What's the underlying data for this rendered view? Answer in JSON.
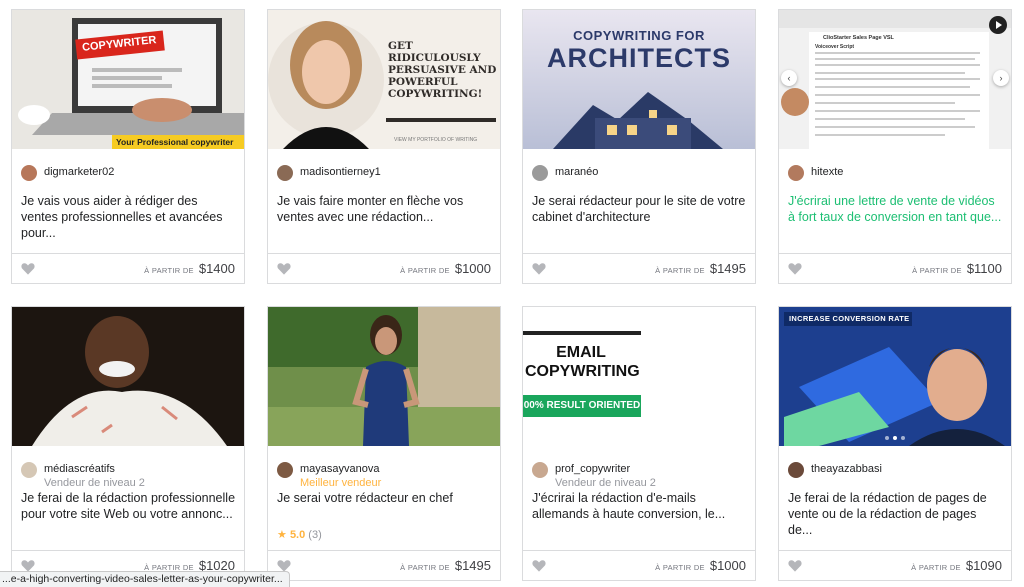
{
  "status_url": "...e-a-high-converting-video-sales-letter-as-your-copywriter...",
  "price_prefix": "À PARTIR DE",
  "accent": "#1dbf73",
  "gigs": [
    {
      "seller": "digmarketer02",
      "level": "",
      "title": "Je vais vous aider à rédiger des ventes professionnelles et avancées pour...",
      "price": "$1400",
      "image": {
        "headline": "COPYWRITER",
        "caption": "Your Professional copywriter"
      }
    },
    {
      "seller": "madisontierney1",
      "level": "",
      "title": "Je vais faire monter en flèche vos ventes avec une rédaction...",
      "price": "$1000",
      "image": {
        "headline": "GET RIDICULOUSLY PERSUASIVE AND POWERFUL COPYWRITING!",
        "caption": "VIEW MY PORTFOLIO OF WRITING"
      }
    },
    {
      "seller": "maranéo",
      "level": "",
      "title": "Je serai rédacteur pour le site de votre cabinet d'architecture",
      "price": "$1495",
      "image": {
        "headline": "COPYWRITING FOR",
        "caption": "ARCHITECTS"
      }
    },
    {
      "seller": "hitexte",
      "level": "",
      "title": "J'écrirai une lettre de vente de vidéos à fort taux de conversion en tant que...",
      "price": "$1100",
      "image": {
        "headline": "ClioStarter Sales Page VSL",
        "caption": "Voiceover Script"
      }
    },
    {
      "seller": "médiascréatifs",
      "level": "Vendeur de niveau 2",
      "title": "Je ferai de la rédaction professionnelle pour votre site Web ou votre annonc...",
      "price": "$1020",
      "image": {
        "headline": "",
        "caption": ""
      }
    },
    {
      "seller": "mayasayvanova",
      "level": "Meilleur vendeur",
      "title": "Je serai votre rédacteur en chef",
      "price": "$1495",
      "rating": {
        "score": "5.0",
        "count": "(3)"
      },
      "image": {
        "headline": "",
        "caption": ""
      }
    },
    {
      "seller": "prof_copywriter",
      "level": "Vendeur de niveau 2",
      "title": "J'écrirai la rédaction d'e-mails allemands à haute conversion, le...",
      "price": "$1000",
      "image": {
        "headline": "EMAIL COPYWRITING",
        "caption": "00% RESULT ORIENTED"
      }
    },
    {
      "seller": "theayazabbasi",
      "level": "",
      "title": "Je ferai de la rédaction de pages de vente ou de la rédaction de pages de...",
      "price": "$1090",
      "image": {
        "headline": "INCREASE CONVERSION RATE",
        "caption": ""
      }
    }
  ]
}
